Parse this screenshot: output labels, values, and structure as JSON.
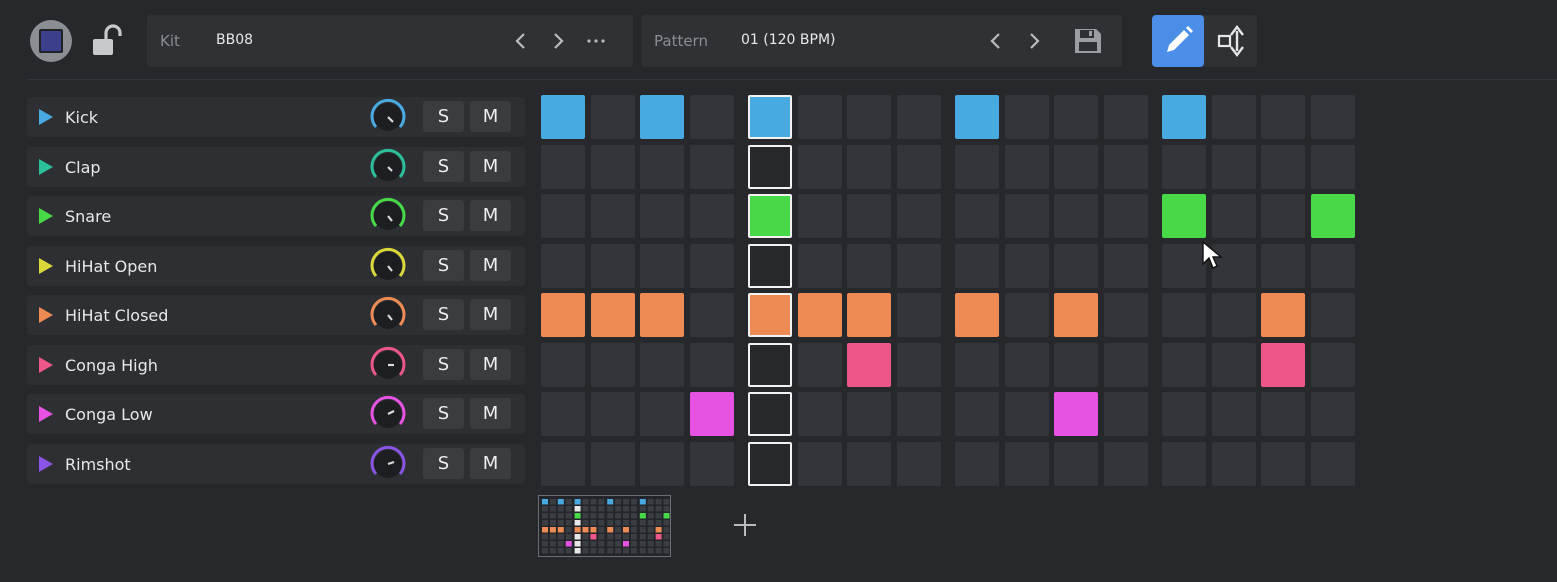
{
  "toolbar": {
    "kit_label": "Kit",
    "kit_value": "BB08",
    "pattern_label": "Pattern",
    "pattern_value": "01 (120 BPM)",
    "icons": [
      "stop-icon",
      "unlocked-icon",
      "chevron-left-icon",
      "chevron-right-icon",
      "more-icon",
      "save-icon",
      "pencil-icon",
      "resize-vertical-icon"
    ],
    "active_tool": "pencil"
  },
  "colors": {
    "background": "#26282b",
    "panel": "#2f3134",
    "empty_cell": "#33353a",
    "accent": "#4a8ee8"
  },
  "tracks": [
    {
      "name": "Kick",
      "color": "#48aae0",
      "solo": "S",
      "mute": "M",
      "steps": [
        1,
        0,
        1,
        0,
        1,
        0,
        0,
        0,
        1,
        0,
        0,
        0,
        1,
        0,
        0,
        0
      ]
    },
    {
      "name": "Clap",
      "color": "#2bbf9a",
      "solo": "S",
      "mute": "M",
      "steps": [
        0,
        0,
        0,
        0,
        0,
        0,
        0,
        0,
        0,
        0,
        0,
        0,
        0,
        0,
        0,
        0
      ]
    },
    {
      "name": "Snare",
      "color": "#47d948",
      "solo": "S",
      "mute": "M",
      "steps": [
        0,
        0,
        0,
        0,
        1,
        0,
        0,
        0,
        0,
        0,
        0,
        0,
        1,
        0,
        0,
        1
      ]
    },
    {
      "name": "HiHat Open",
      "color": "#dbd93a",
      "solo": "S",
      "mute": "M",
      "steps": [
        0,
        0,
        0,
        0,
        0,
        0,
        0,
        0,
        0,
        0,
        0,
        0,
        0,
        0,
        0,
        0
      ]
    },
    {
      "name": "HiHat Closed",
      "color": "#ee8a54",
      "solo": "S",
      "mute": "M",
      "steps": [
        1,
        1,
        1,
        0,
        1,
        1,
        1,
        0,
        1,
        0,
        1,
        0,
        0,
        0,
        1,
        0
      ]
    },
    {
      "name": "Conga High",
      "color": "#ec5688",
      "solo": "S",
      "mute": "M",
      "steps": [
        0,
        0,
        0,
        0,
        0,
        0,
        1,
        0,
        0,
        0,
        0,
        0,
        0,
        0,
        1,
        0
      ]
    },
    {
      "name": "Conga Low",
      "color": "#e653e3",
      "solo": "S",
      "mute": "M",
      "steps": [
        0,
        0,
        0,
        1,
        0,
        0,
        0,
        0,
        0,
        0,
        1,
        0,
        0,
        0,
        0,
        0
      ]
    },
    {
      "name": "Rimshot",
      "color": "#8a55e6",
      "solo": "S",
      "mute": "M",
      "steps": [
        0,
        0,
        0,
        0,
        0,
        0,
        0,
        0,
        0,
        0,
        0,
        0,
        0,
        0,
        0,
        0
      ]
    }
  ],
  "playhead_step": 5,
  "patterns": {
    "thumbnails": 1,
    "add_icon": "plus-icon"
  }
}
